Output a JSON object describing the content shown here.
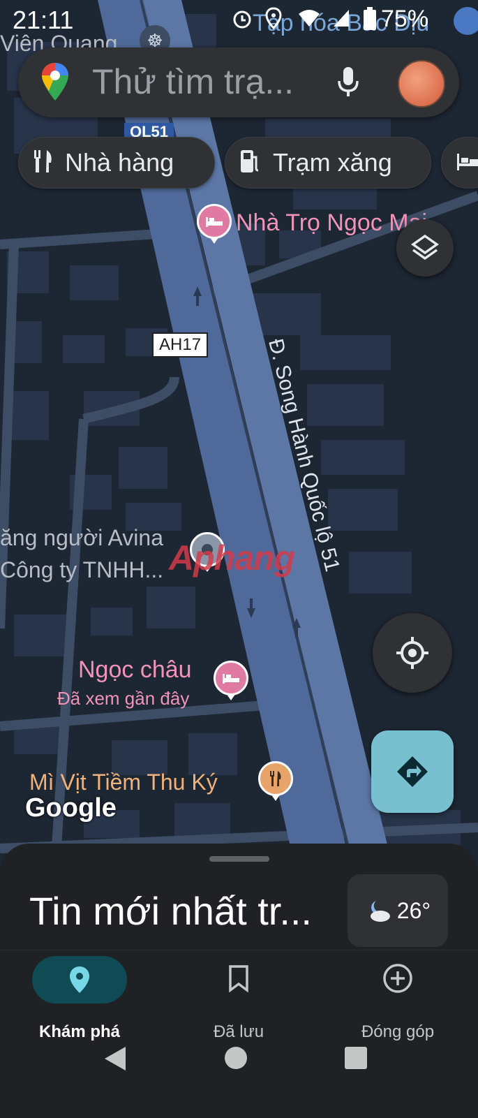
{
  "status_bar": {
    "time": "21:11",
    "battery": "75%",
    "overlay_place_label": "Tạp hóa Bắc Dịu",
    "icons": [
      "alarm-icon",
      "location-icon",
      "wifi-icon",
      "signal-icon",
      "battery-icon"
    ]
  },
  "search": {
    "placeholder": "Thử tìm trạ...",
    "mic_icon": "mic-icon",
    "logo_icon": "maps-pin-logo-icon",
    "avatar_icon": "avatar"
  },
  "chips": [
    {
      "label": "Nhà hàng",
      "icon": "restaurant-icon"
    },
    {
      "label": "Trạm xăng",
      "icon": "gas-station-icon"
    },
    {
      "label": "",
      "icon": "hotel-icon"
    }
  ],
  "map": {
    "top_left_label": "Viên Quang",
    "road_shield_top": "QL51",
    "road_shield_mid": "AH17",
    "road_name": "Đ. Song Hành Quốc lộ 51",
    "places": {
      "nha_tro": "Nhà Trọ Ngọc Mai",
      "avina_line1": "ăng người Avina",
      "avina_line2": "Công ty TNHH...",
      "ngoc_chau": "Ngọc châu",
      "ngoc_chau_sub": "Đã xem gần đây",
      "mi_vit": "Mì Vịt Tiềm Thu Ký"
    },
    "google_logo": "Google",
    "watermark": "Aphang"
  },
  "sheet": {
    "title": "Tin mới nhất tr...",
    "weather_temp": "26°",
    "weather_icon": "partly-cloudy-night-icon"
  },
  "bottom_nav": [
    {
      "label": "Khám phá",
      "icon": "explore-pin-icon",
      "active": true
    },
    {
      "label": "Đã lưu",
      "icon": "bookmark-icon",
      "active": false
    },
    {
      "label": "Đóng góp",
      "icon": "add-circle-icon",
      "active": false
    }
  ],
  "colors": {
    "map_bg": "#1d2633",
    "road": "#4f6a9a",
    "accent_teal": "#78c0cf",
    "pink_poi": "#f093b6",
    "orange_poi": "#f0b27a"
  }
}
